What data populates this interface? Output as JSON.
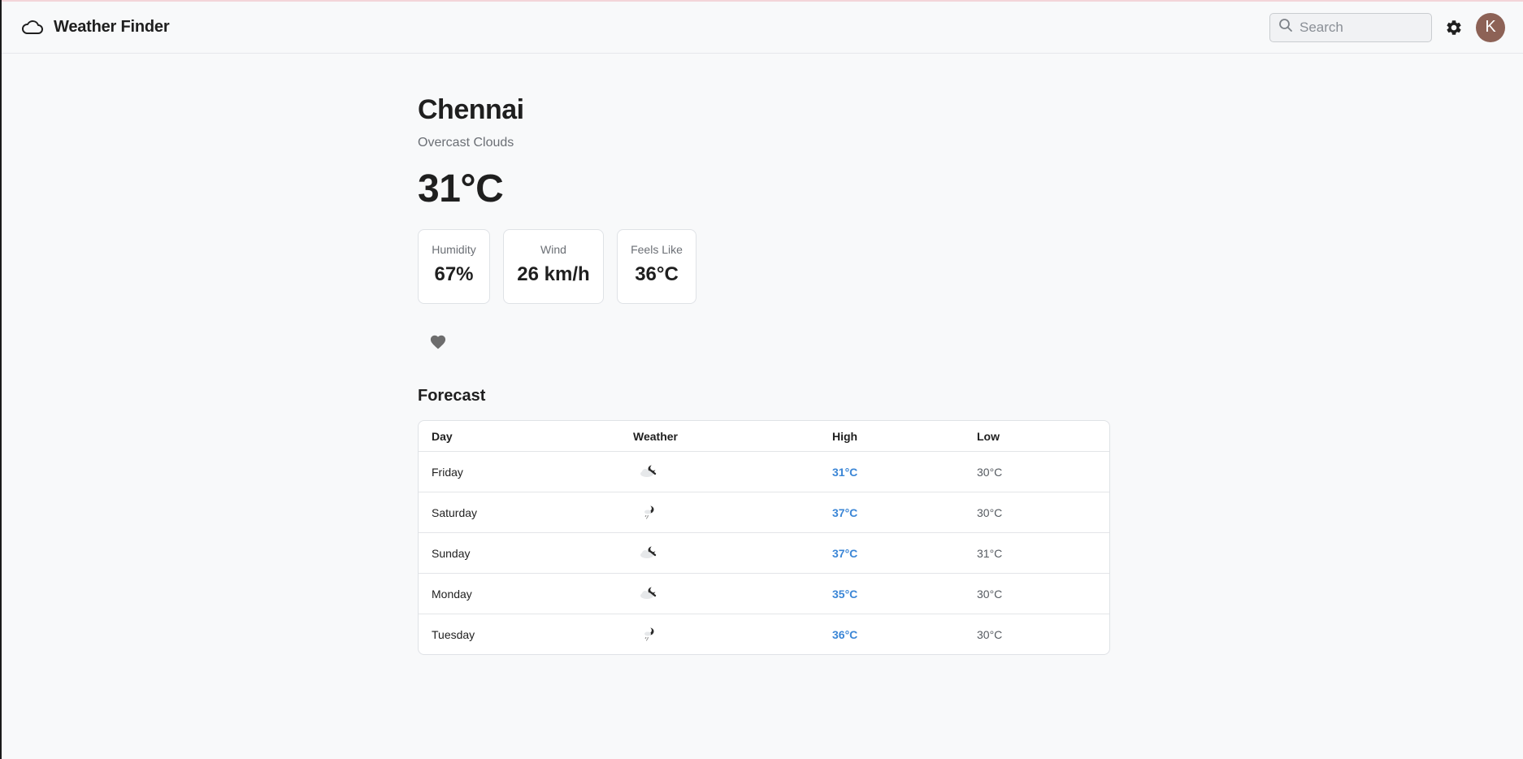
{
  "app": {
    "title": "Weather Finder"
  },
  "search": {
    "placeholder": "Search"
  },
  "user": {
    "avatar_initial": "K",
    "avatar_color": "#8d6256"
  },
  "current": {
    "city": "Chennai",
    "description": "Overcast Clouds",
    "temperature": "31°C",
    "stats": [
      {
        "label": "Humidity",
        "value": "67%"
      },
      {
        "label": "Wind",
        "value": "26 km/h"
      },
      {
        "label": "Feels Like",
        "value": "36°C"
      }
    ]
  },
  "forecast": {
    "title": "Forecast",
    "columns": [
      "Day",
      "Weather",
      "High",
      "Low"
    ],
    "rows": [
      {
        "day": "Friday",
        "icon": "cloudy-night-icon",
        "high": "31°C",
        "low": "30°C"
      },
      {
        "day": "Saturday",
        "icon": "rain-night-icon",
        "high": "37°C",
        "low": "30°C"
      },
      {
        "day": "Sunday",
        "icon": "cloudy-night-icon",
        "high": "37°C",
        "low": "31°C"
      },
      {
        "day": "Monday",
        "icon": "cloudy-night-icon",
        "high": "35°C",
        "low": "30°C"
      },
      {
        "day": "Tuesday",
        "icon": "rain-night-icon",
        "high": "36°C",
        "low": "30°C"
      }
    ]
  },
  "colors": {
    "accent": "#3b86d6",
    "background": "#f8f9fa"
  }
}
